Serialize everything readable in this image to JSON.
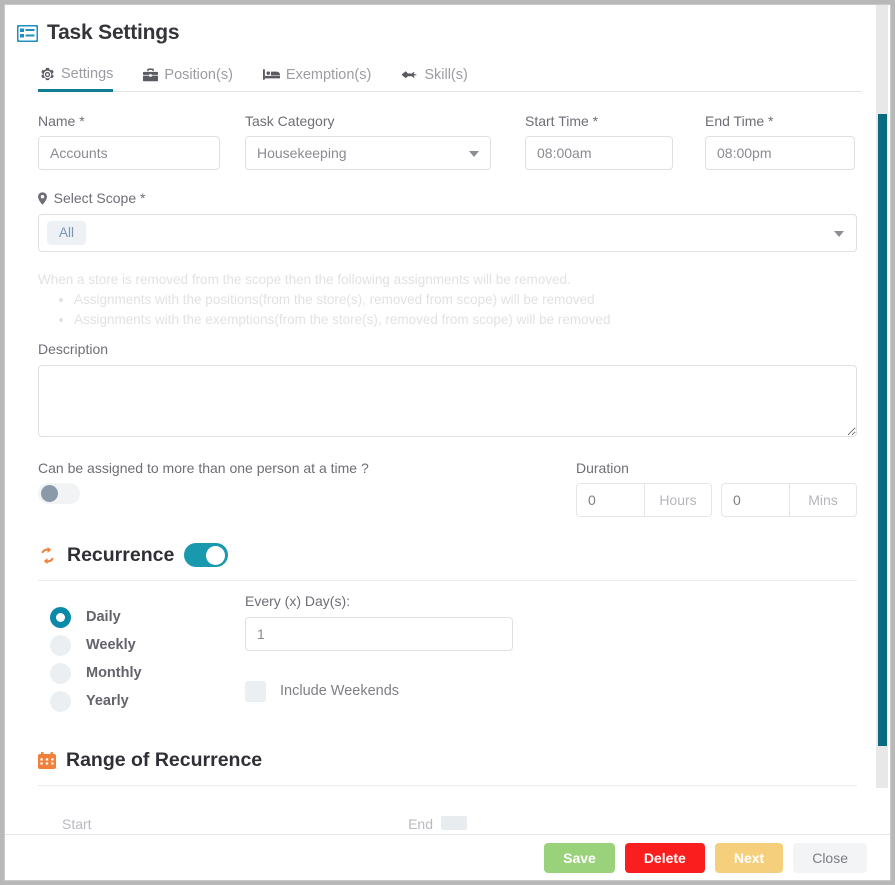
{
  "window": {
    "title": "Task Settings",
    "title_icon": "list-alt-icon"
  },
  "tabs": [
    {
      "label": "Settings",
      "icon": "gear-icon",
      "active": true
    },
    {
      "label": "Position(s)",
      "icon": "briefcase-icon",
      "active": false
    },
    {
      "label": "Exemption(s)",
      "icon": "bed-icon",
      "active": false
    },
    {
      "label": "Skill(s)",
      "icon": "jet-icon",
      "active": false
    }
  ],
  "form": {
    "name": {
      "label": "Name *",
      "value": "Accounts"
    },
    "task_category": {
      "label": "Task Category",
      "value": "Housekeeping",
      "icon": "chevron-down-icon"
    },
    "start_time": {
      "label": "Start Time *",
      "value": "08:00am"
    },
    "end_time": {
      "label": "End Time *",
      "value": "08:00pm"
    },
    "select_scope": {
      "label": "Select Scope *",
      "icon": "map-pin-icon",
      "chip": "All",
      "caret": "chevron-down-icon"
    },
    "scope_note": {
      "intro": "When a store is removed from the scope then the following assignments will be removed.",
      "bullets": [
        "Assignments with the positions(from the store(s), removed from scope) will be removed",
        "Assignments with the exemptions(from the store(s), removed from scope) will be removed"
      ]
    },
    "description": {
      "label": "Description",
      "value": "",
      "placeholder": ""
    },
    "multi_assign": {
      "label": "Can be assigned to more than one person at a time ?",
      "state": "off"
    },
    "duration": {
      "label": "Duration",
      "hours_value": "0",
      "hours_addon": "Hours",
      "mins_value": "0",
      "mins_addon": "Mins"
    }
  },
  "recurrence": {
    "title": "Recurrence",
    "icon": "refresh-icon",
    "toggle_state": "on",
    "options": [
      {
        "label": "Daily",
        "selected": true
      },
      {
        "label": "Weekly",
        "selected": false
      },
      {
        "label": "Monthly",
        "selected": false
      },
      {
        "label": "Yearly",
        "selected": false
      }
    ],
    "every_label": "Every (x) Day(s):",
    "every_value": "1",
    "include_weekends": {
      "label": "Include Weekends",
      "checked": false
    }
  },
  "range_of_recurrence": {
    "title": "Range of Recurrence",
    "icon": "calendar-icon",
    "start_label": "Start",
    "end_label": "End"
  },
  "footer": {
    "save": "Save",
    "delete": "Delete",
    "next": "Next",
    "close": "Close"
  },
  "colors": {
    "accent_teal": "#127d94",
    "toggle_on": "#1899ad",
    "radio_selected": "#0a8aa8",
    "section_icon_orange": "#f1803a",
    "save_green": "#9ad27b",
    "delete_red": "#fa1e1e",
    "next_yellow": "#f5cf7c",
    "close_gray": "#f3f4f5",
    "scrollbar_thumb": "#0a6a80"
  }
}
